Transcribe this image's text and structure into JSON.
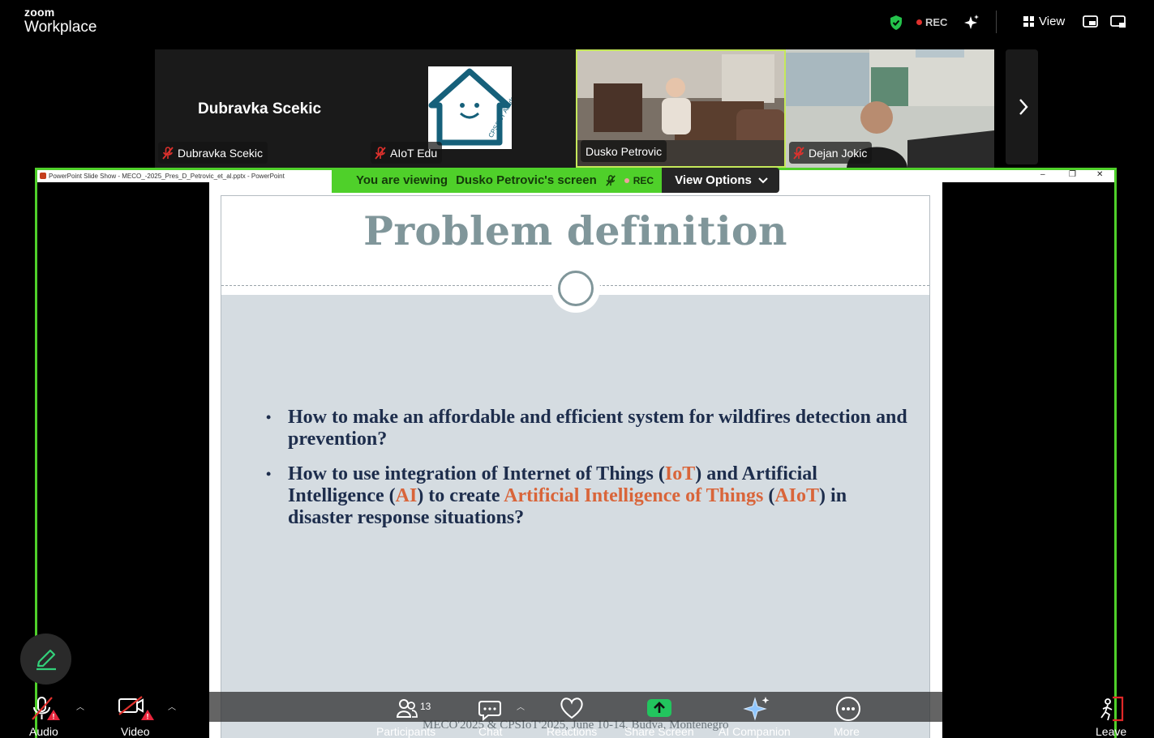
{
  "app": {
    "brand_top": "zoom",
    "brand_bottom": "Workplace"
  },
  "topbar": {
    "rec": "REC",
    "view": "View"
  },
  "participants": {
    "dubravka_big": "Dubravka Scekic",
    "dubravka": "Dubravka Scekic",
    "aiot": "AIoT Edu",
    "aiot_logo_text": "CPS&IoT Academy",
    "dusko": "Dusko Petrovic",
    "dejan": "Dejan Jokic"
  },
  "banner": {
    "viewing_prefix": "You are viewing",
    "viewing_name": "Dusko Petrovic's screen",
    "rec": "REC",
    "view_options": "View Options"
  },
  "ppt": {
    "window_title": "PowerPoint Slide Show  -  MECO_-2025_Pres_D_Petrovic_et_al.pptx  -  PowerPoint"
  },
  "slide": {
    "title": "Problem definition",
    "b1": "How to make an affordable and efficient system for wildfires detection and prevention?",
    "b2_a": "How to use integration of Internet of Things (",
    "b2_iot": "IoT",
    "b2_b": ") and Artificial Intelligence (",
    "b2_ai": "AI",
    "b2_c": ") to create ",
    "b2_aiot_full": "Artificial Intelligence of Things",
    "b2_d": " (",
    "b2_aiot": "AIoT",
    "b2_e": ") in disaster response situations?",
    "footer": "MECO'2025 & CPSIoT'2025, June 10-14, Budva, Montenegro"
  },
  "toolbar": {
    "audio": "Audio",
    "video": "Video",
    "participants": "Participants",
    "participants_count": "13",
    "chat": "Chat",
    "reactions": "Reactions",
    "share": "Share Screen",
    "ai": "AI Companion",
    "more": "More",
    "leave": "Leave"
  },
  "colors": {
    "accent_green": "#4fd02a",
    "rec_red": "#e0312d",
    "slide_title": "#80969a",
    "slide_text": "#1d2d4c",
    "slide_highlight": "#d9653a",
    "leave_red": "#e02828"
  },
  "icons": [
    "shield-icon",
    "sparkle-icon",
    "grid-icon",
    "minimize-window-icon",
    "pip-icon",
    "mic-off-icon",
    "chevron-right-icon",
    "chevron-down-icon",
    "pencil-icon",
    "video-off-icon",
    "warning-icon",
    "participants-icon",
    "chat-icon",
    "heart-icon",
    "share-arrow-icon",
    "ai-sparkle-icon",
    "more-dots-icon",
    "leave-door-icon"
  ]
}
